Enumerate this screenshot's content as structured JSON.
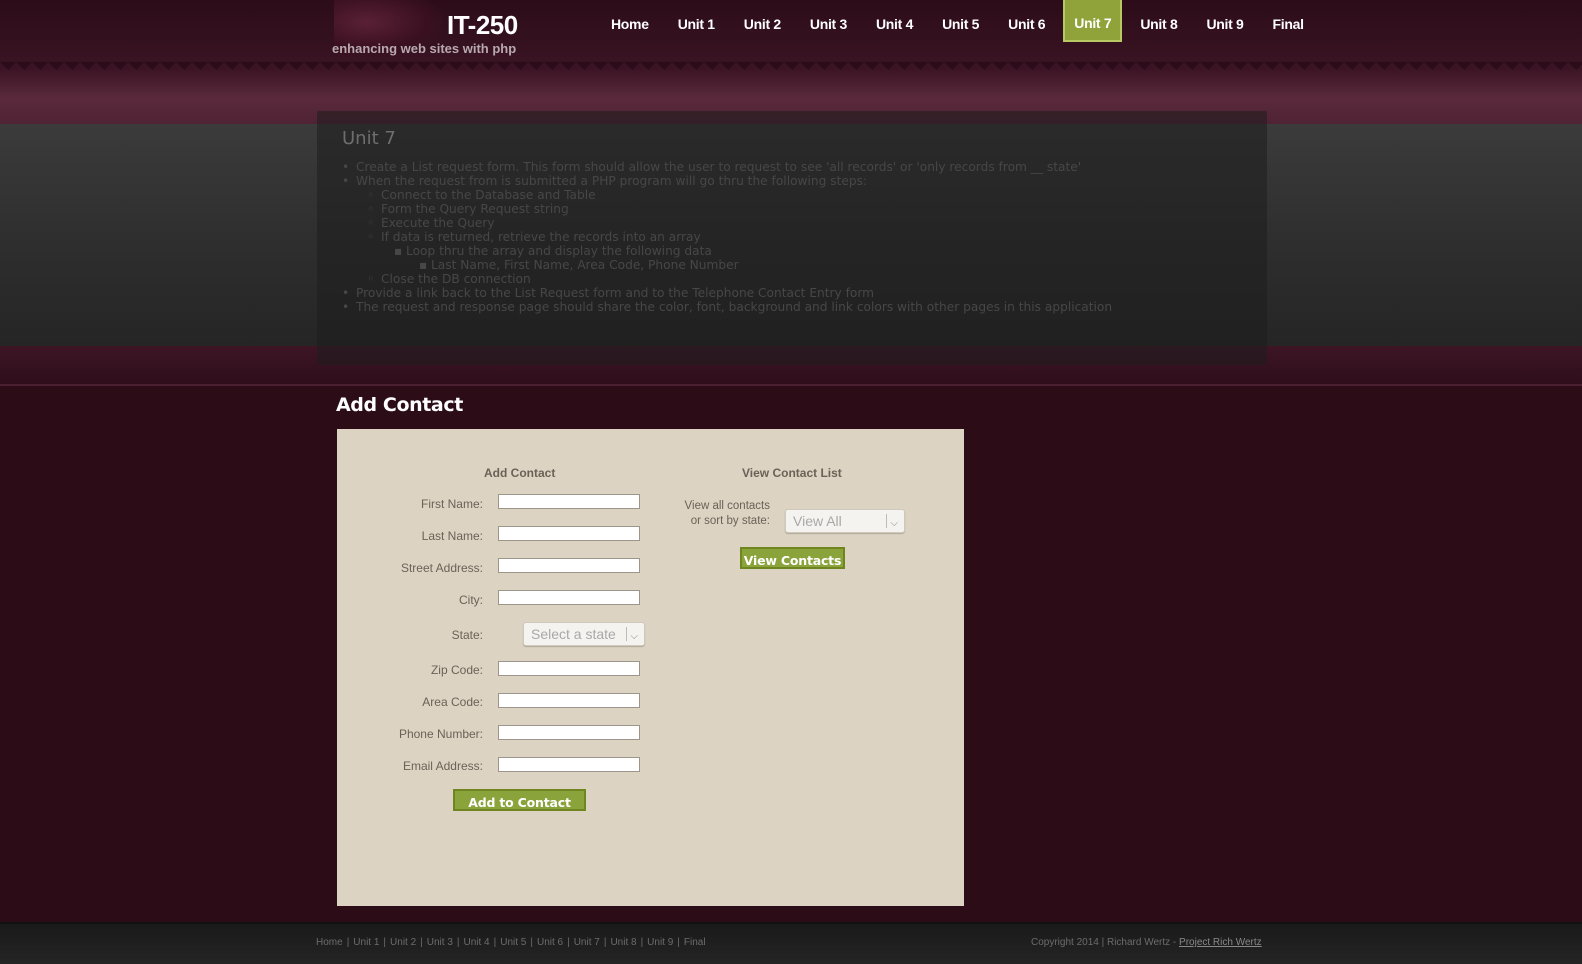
{
  "header": {
    "logo_title": "IT-250",
    "logo_subtitle": "enhancing web sites with php",
    "nav": [
      {
        "label": "Home"
      },
      {
        "label": "Unit 1"
      },
      {
        "label": "Unit 2"
      },
      {
        "label": "Unit 3"
      },
      {
        "label": "Unit 4"
      },
      {
        "label": "Unit 5"
      },
      {
        "label": "Unit 6"
      },
      {
        "label": "Unit 7",
        "active": true
      },
      {
        "label": "Unit 8"
      },
      {
        "label": "Unit 9"
      },
      {
        "label": "Final"
      }
    ]
  },
  "info": {
    "title": "Unit 7",
    "items": [
      {
        "level": 1,
        "text": "Create a List request form. This form should allow the user to request to see 'all records' or 'only records from __ state'"
      },
      {
        "level": 1,
        "text": "When the request from is submitted a PHP program will go thru the following steps:"
      },
      {
        "level": 2,
        "text": "Connect to the Database and Table"
      },
      {
        "level": 2,
        "text": "Form the Query Request string"
      },
      {
        "level": 2,
        "text": "Execute the Query"
      },
      {
        "level": 2,
        "text": "If data is returned, retrieve the records into an array"
      },
      {
        "level": 3,
        "text": "Loop thru the array and display the following data"
      },
      {
        "level": 4,
        "text": "Last Name, First Name, Area Code, Phone Number"
      },
      {
        "level": 2,
        "text": "Close the DB connection"
      },
      {
        "level": 1,
        "text": "Provide a link back to the List Request form and to the Telephone Contact Entry form"
      },
      {
        "level": 1,
        "text": "The request and response page should share the color, font, background and link colors with other pages in this application"
      }
    ]
  },
  "main": {
    "heading": "Add Contact",
    "add_form": {
      "title": "Add Contact",
      "fields": [
        {
          "label": "First Name:",
          "value": ""
        },
        {
          "label": "Last Name:",
          "value": ""
        },
        {
          "label": "Street Address:",
          "value": ""
        },
        {
          "label": "City:",
          "value": ""
        },
        {
          "label": "State:",
          "placeholder": "Select a state"
        },
        {
          "label": "Zip Code:",
          "value": ""
        },
        {
          "label": "Area Code:",
          "value": ""
        },
        {
          "label": "Phone Number:",
          "value": ""
        },
        {
          "label": "Email Address:",
          "value": ""
        }
      ],
      "submit_label": "Add to Contact List"
    },
    "view_form": {
      "title": "View Contact List",
      "prompt_line1": "View all contacts",
      "prompt_line2": "or sort by state:",
      "select_value": "View All",
      "submit_label": "View Contacts"
    }
  },
  "footer": {
    "nav": [
      "Home",
      "Unit 1",
      "Unit 2",
      "Unit 3",
      "Unit 4",
      "Unit 5",
      "Unit 6",
      "Unit 7",
      "Unit 8",
      "Unit 9",
      "Final"
    ],
    "copyright": "Copyright 2014 | Richard Wertz - ",
    "link_label": "Project Rich Wertz"
  },
  "colors": {
    "accent_green": "#8ba33b",
    "card_bg": "#dcd3c2",
    "page_bg": "#2b0c17"
  }
}
